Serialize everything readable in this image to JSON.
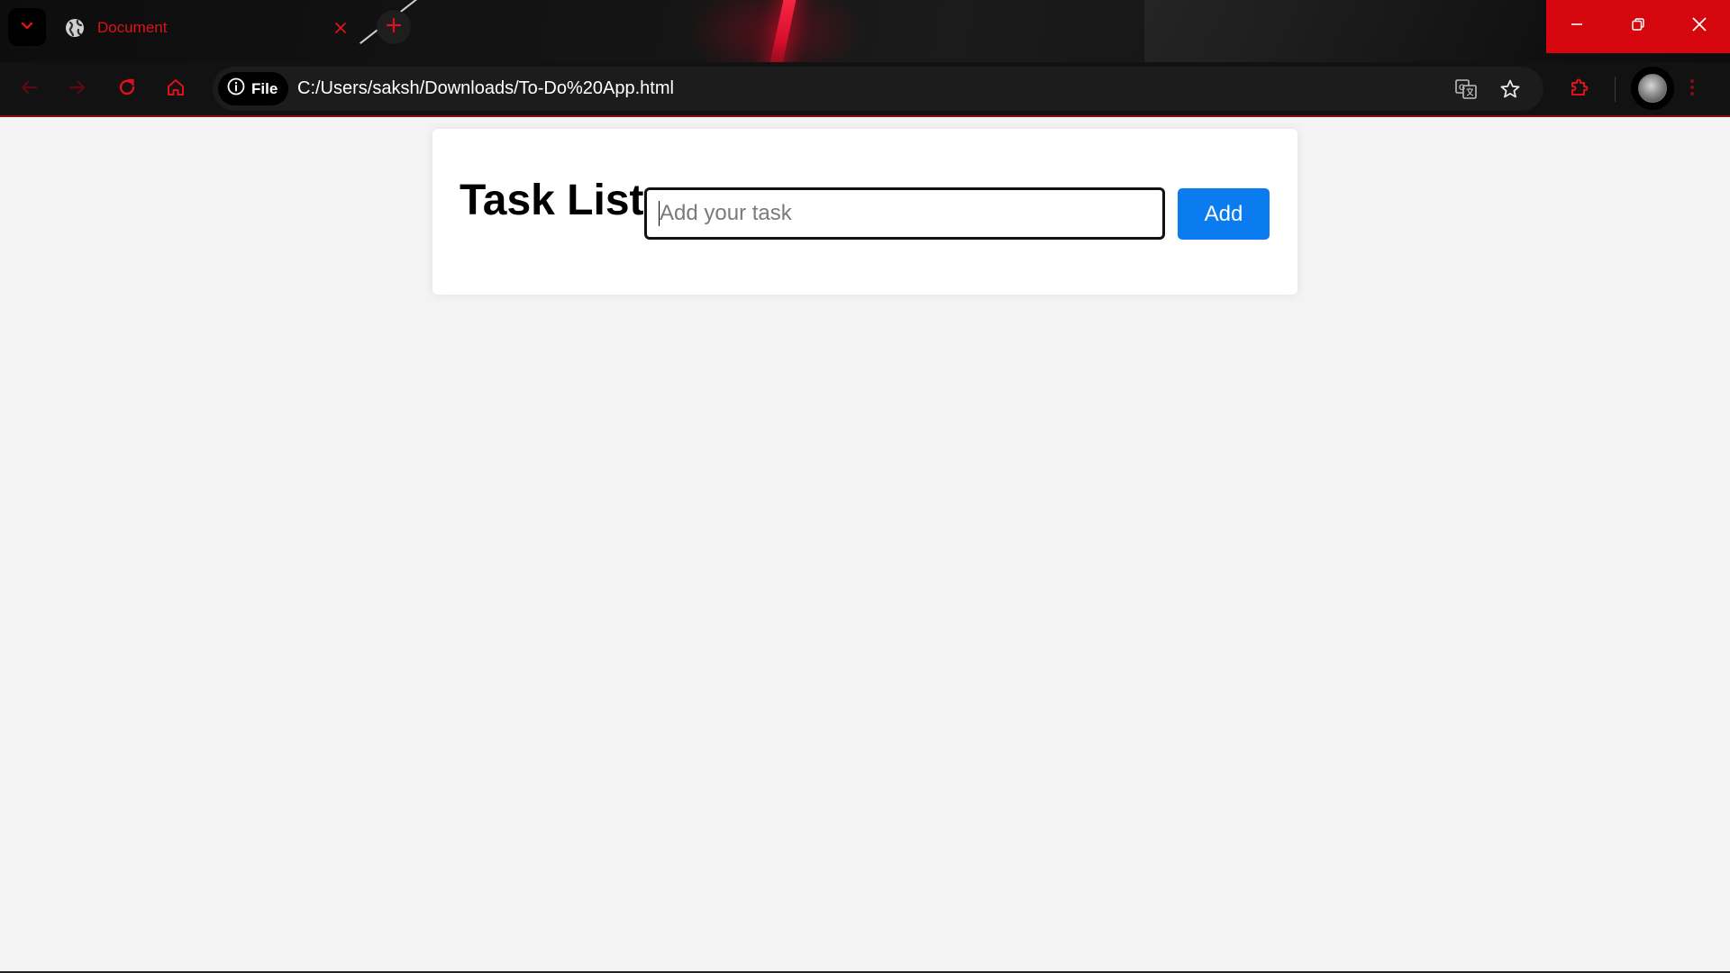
{
  "browser": {
    "tab": {
      "title": "Document",
      "icon": "globe-icon",
      "close_icon": "close-icon"
    },
    "tab_search_icon": "chevron-down-icon",
    "new_tab_icon": "plus-icon",
    "window_controls": [
      "minimize-icon",
      "restore-icon",
      "close-icon"
    ],
    "toolbar": {
      "back_icon": "arrow-left-icon",
      "forward_icon": "arrow-right-icon",
      "reload_icon": "reload-icon",
      "home_icon": "home-icon",
      "site_info_label": "File",
      "site_info_icon": "info-icon",
      "url": "C:/Users/saksh/Downloads/To-Do%20App.html",
      "translate_icon": "translate-icon",
      "bookmark_icon": "star-icon",
      "extensions_icon": "puzzle-icon",
      "profile_icon": "avatar",
      "menu_icon": "kebab-menu-icon"
    },
    "colors": {
      "accent": "#e0101c",
      "window_control_bg": "#d6060f",
      "toolbar_bg": "#121212"
    }
  },
  "page": {
    "heading": "Task List",
    "task_input": {
      "placeholder": "Add your task",
      "value": ""
    },
    "add_button_label": "Add",
    "colors": {
      "background": "#f3f3f3",
      "card": "#ffffff",
      "button": "#0a7cf0"
    }
  }
}
